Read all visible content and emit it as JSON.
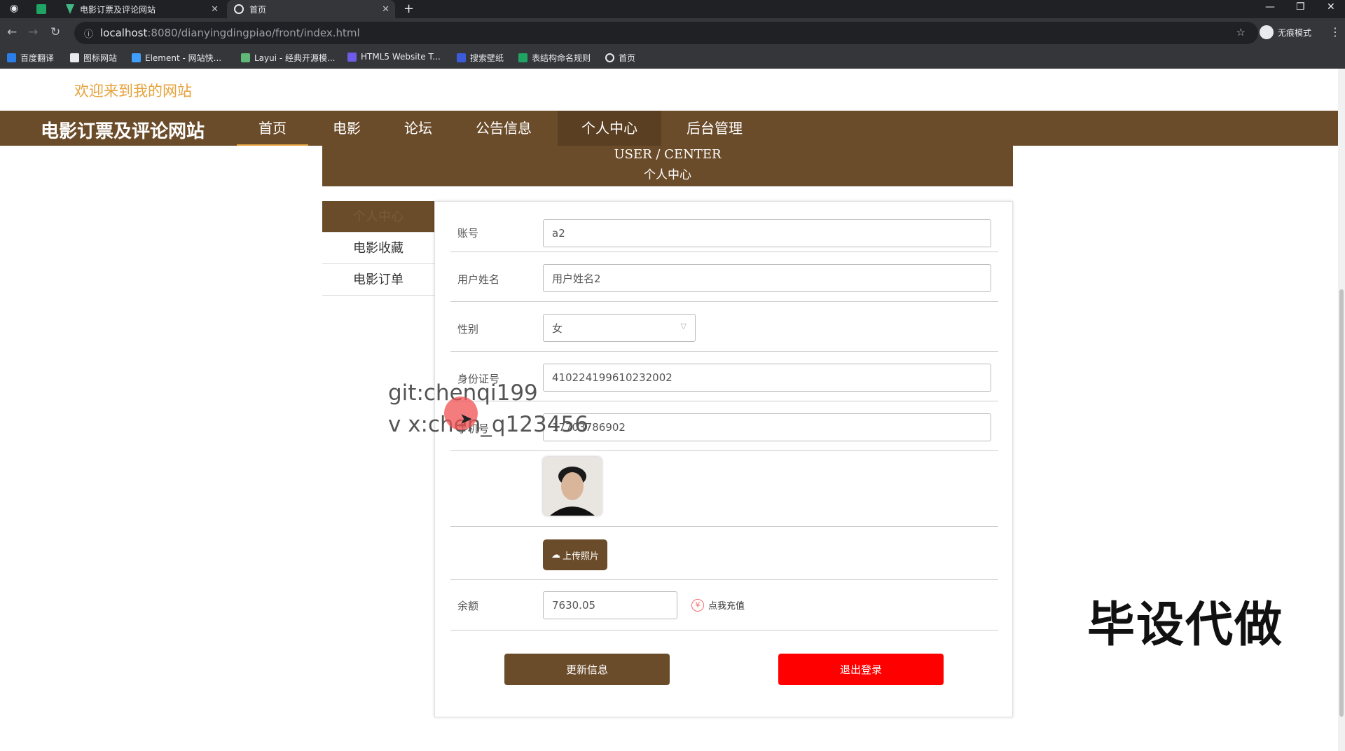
{
  "browser": {
    "tabs": [
      {
        "title": "电影订票及评论网站"
      },
      {
        "title": "首页"
      }
    ],
    "url_host": "localhost",
    "url_path": ":8080/dianyingdingpiao/front/index.html",
    "profile_label": "无痕模式",
    "bookmarks": [
      "百度翻译",
      "图标网站",
      "Element - 网站快...",
      "Layui - 经典开源模...",
      "HTML5 Website T...",
      "搜索壁纸",
      "表结构命名规则",
      "首页"
    ]
  },
  "site": {
    "welcome": "欢迎来到我的网站",
    "brand": "电影订票及评论网站",
    "nav": [
      "首页",
      "电影",
      "论坛",
      "公告信息",
      "个人中心",
      "后台管理"
    ],
    "banner_en": "USER / CENTER",
    "banner_cn": "个人中心"
  },
  "sidebar": {
    "items": [
      "个人中心",
      "电影收藏",
      "电影订单"
    ]
  },
  "form": {
    "account_label": "账号",
    "account_value": "a2",
    "name_label": "用户姓名",
    "name_value": "用户姓名2",
    "gender_label": "性别",
    "gender_value": "女",
    "idcard_label": "身份证号",
    "idcard_value": "410224199610232002",
    "phone_label": "手机号",
    "phone_value": "17703786902",
    "upload_label": "上传照片",
    "balance_label": "余额",
    "balance_value": "7630.05",
    "recharge_label": "点我充值",
    "update_label": "更新信息",
    "logout_label": "退出登录"
  },
  "overlay": {
    "watermark_line1": "git:chenqi199",
    "watermark_line2": "v x:chen_q123456",
    "corner_text": "毕设代做"
  },
  "colors": {
    "brand_brown": "#6b4c2a",
    "welcome_orange": "#e6a23c",
    "logout_red": "#ff0000"
  }
}
